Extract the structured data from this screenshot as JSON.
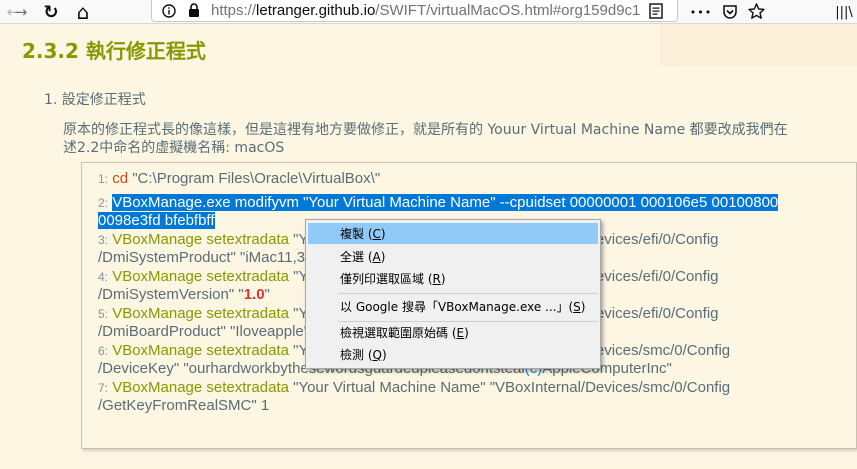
{
  "toolbar": {
    "back_glyph": "←",
    "forward_glyph": "→",
    "reload_glyph": "↻",
    "home_glyph": "⌂",
    "url_scheme": "https://",
    "url_host": "letranger.github.io",
    "url_path": "/SWIFT/virtualMacOS.html#org159d9c1",
    "more_glyph": "•••",
    "library_glyph": "|||\\"
  },
  "icons": [
    "back-icon",
    "forward-icon",
    "reload-icon",
    "home-icon",
    "info-icon",
    "lock-icon",
    "reader-view-icon",
    "more-actions-icon",
    "pocket-icon",
    "bookmark-star-icon",
    "library-icon"
  ],
  "page": {
    "heading": "2.3.2 執行修正程式",
    "list_item": "1. 設定修正程式",
    "para_line1": "原本的修正程式長的像這樣，但是這裡有地方要做修正，就是所有的 Youur Virtual Machine Name 都要改成我們在",
    "para_line2": "述2.2中命名的虛擬機名稱: macOS"
  },
  "code": {
    "l1_num": "1:",
    "l1_cmd": "cd",
    "l1_arg": " \"C:\\Program Files\\Oracle\\VirtualBox\\\"",
    "l2_num": "2:",
    "l2_sel_a": "VBoxManage.exe modifyvm \"Your Virtual Machine Name\" --cpuidset 00000001 000106e5 00100800",
    "l2_sel_b": "0098e3fd bfebfbff",
    "l3_num": "3:",
    "l3_cmd": "VBoxManage setextradata",
    "l3_rest": " \"Your Virtual Machine Name\" \"VBoxInternal/Devices/efi/0/Config",
    "l3b": "/DmiSystemProduct\" \"iMac11,3\"",
    "l4_num": "4:",
    "l4_cmd": "VBoxManage setextradata",
    "l4_rest": " \"Your Virtual Machine Name\" \"VBoxInternal/Devices/efi/0/Config",
    "l4b_pre": "/DmiSystemVersion\" \"",
    "l4b_val": "1.0",
    "l4b_post": "\"",
    "l5_num": "5:",
    "l5_cmd": "VBoxManage setextradata",
    "l5_rest": " \"Your Virtual Machine Name\" \"VBoxInternal/Devices/efi/0/Config",
    "l5b": "/DmiBoardProduct\" \"Iloveapple\"",
    "l6_num": "6:",
    "l6_cmd": "VBoxManage setextradata",
    "l6_rest": " \"Your Virtual Machine Name\" \"VBoxInternal/Devices/smc/0/Config",
    "l6b_pre": "/DeviceKey\" \"ourhardworkbythesewordsguardedpleasedontsteal",
    "l6b_paren": "(c)",
    "l6b_post": "AppleComputerInc\"",
    "l7_num": "7:",
    "l7_cmd": "VBoxManage setextradata",
    "l7_rest": " \"Your Virtual Machine Name\" \"VBoxInternal/Devices/smc/0/Config",
    "l7b": "/GetKeyFromRealSMC\" 1"
  },
  "context_menu": {
    "copy": "複製 (",
    "copy_key": "C",
    "select_all": "全選 (",
    "select_all_key": "A",
    "print_selection": "僅列印選取區域 (",
    "print_selection_key": "R",
    "search_google": "以 Google 搜尋「VBoxManage.exe ...」(",
    "search_google_key": "S",
    "view_source": "檢視選取範圍原始碼 (",
    "view_source_key": "E",
    "inspect": "檢測 (",
    "inspect_key": "Q",
    "close_paren": ")"
  }
}
